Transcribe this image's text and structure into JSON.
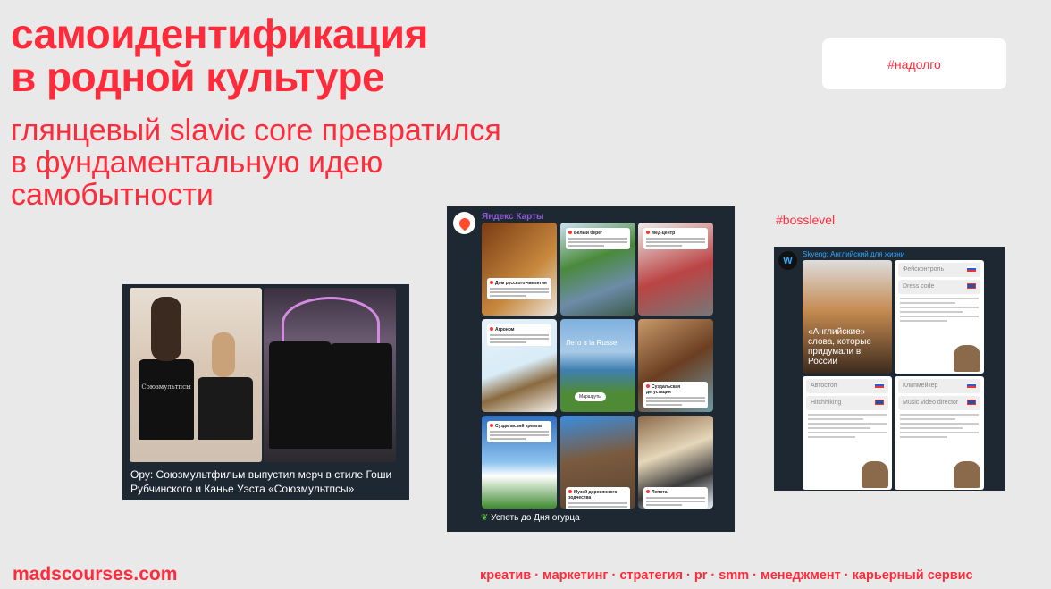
{
  "title": [
    "самоидентификация",
    "в родной культуре"
  ],
  "subtitle": [
    "глянцевый slavic core превратился",
    "в фундаментальную идею",
    "самобытности"
  ],
  "tags": {
    "top": "#надолго",
    "boss": "#bosslevel"
  },
  "merch_card": {
    "shirt_text": "Союзмультпсы",
    "caption": "Ору: Союзмультфильм выпустил мерч в стиле Гоши Рубчинского и Канье Уэста «Союзмультпсы»"
  },
  "yandex_card": {
    "channel": "Яндекс Карты",
    "tiles": [
      "Дом русского чаепития",
      "Белый берег",
      "Мёд-центр",
      "Агроном",
      "Лето в la Russe",
      "Суздальская дегустация",
      "Суздальский кремль",
      "Музей деревянного зодчества",
      "Лепота"
    ],
    "route_button": "Маршруты",
    "footer": "Успеть до Дня огурца"
  },
  "skyeng_card": {
    "channel": "Skyeng: Английский для жизни",
    "cover": "«Английские» слова, которые придумали в России",
    "pairs": [
      [
        "Фейсконтроль",
        "Dress code"
      ],
      [
        "Автостоп",
        "Hitchhiking"
      ],
      [
        "Клипмейкер",
        "Music video director"
      ]
    ]
  },
  "footer": {
    "site": "madscourses.com",
    "tagline": "креатив · маркетинг · стратегия · pr · smm · менеджмент · карьерный сервис"
  },
  "colors": {
    "accent": "#ff2b3a",
    "card": "#1e2833"
  }
}
